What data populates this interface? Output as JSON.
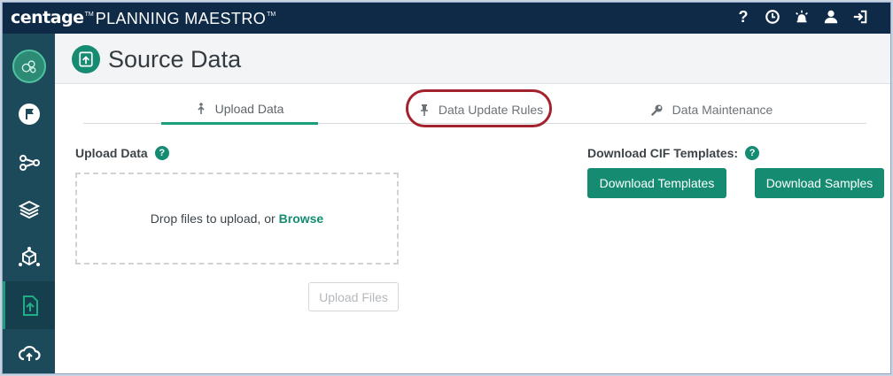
{
  "topbar": {
    "brand": "centage",
    "brand_tm": "TM",
    "product": "PLANNING MAESTRO",
    "product_tm": "TM",
    "icons": [
      "help-icon",
      "clock-icon",
      "alarm-icon",
      "user-icon",
      "logout-icon"
    ],
    "help_glyph": "?"
  },
  "sidebar": {
    "items": [
      {
        "name": "logo-icon"
      },
      {
        "name": "flag-icon"
      },
      {
        "name": "share-nodes-icon"
      },
      {
        "name": "layers-icon"
      },
      {
        "name": "model-cube-icon"
      },
      {
        "name": "upload-file-icon",
        "active": true
      },
      {
        "name": "cloud-upload-icon"
      }
    ]
  },
  "page": {
    "title": "Source Data"
  },
  "tabs": [
    {
      "label": "Upload Data",
      "icon": "upload-arrow-icon",
      "active": true
    },
    {
      "label": "Data Update Rules",
      "icon": "pin-icon",
      "active": false
    },
    {
      "label": "Data Maintenance",
      "icon": "wrench-icon",
      "active": false
    }
  ],
  "upload": {
    "label": "Upload Data",
    "dropzone_text": "Drop files to upload, or",
    "browse_text": "Browse",
    "upload_button": "Upload Files"
  },
  "download": {
    "label": "Download CIF Templates:",
    "templates_button": "Download Templates",
    "samples_button": "Download Samples"
  },
  "colors": {
    "topbar": "#0e2a47",
    "sidebar": "#1d4a5a",
    "accent": "#158c72",
    "annotation": "#a3222d"
  }
}
